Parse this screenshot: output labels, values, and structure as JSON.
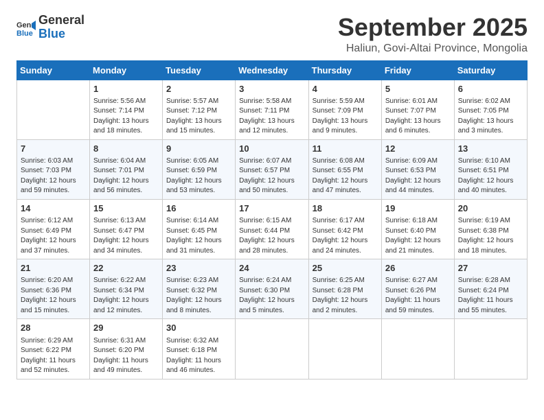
{
  "logo": {
    "general": "General",
    "blue": "Blue"
  },
  "title": "September 2025",
  "location": "Haliun, Govi-Altai Province, Mongolia",
  "days_of_week": [
    "Sunday",
    "Monday",
    "Tuesday",
    "Wednesday",
    "Thursday",
    "Friday",
    "Saturday"
  ],
  "weeks": [
    [
      {
        "day": "",
        "info": ""
      },
      {
        "day": "1",
        "info": "Sunrise: 5:56 AM\nSunset: 7:14 PM\nDaylight: 13 hours\nand 18 minutes."
      },
      {
        "day": "2",
        "info": "Sunrise: 5:57 AM\nSunset: 7:12 PM\nDaylight: 13 hours\nand 15 minutes."
      },
      {
        "day": "3",
        "info": "Sunrise: 5:58 AM\nSunset: 7:11 PM\nDaylight: 13 hours\nand 12 minutes."
      },
      {
        "day": "4",
        "info": "Sunrise: 5:59 AM\nSunset: 7:09 PM\nDaylight: 13 hours\nand 9 minutes."
      },
      {
        "day": "5",
        "info": "Sunrise: 6:01 AM\nSunset: 7:07 PM\nDaylight: 13 hours\nand 6 minutes."
      },
      {
        "day": "6",
        "info": "Sunrise: 6:02 AM\nSunset: 7:05 PM\nDaylight: 13 hours\nand 3 minutes."
      }
    ],
    [
      {
        "day": "7",
        "info": "Sunrise: 6:03 AM\nSunset: 7:03 PM\nDaylight: 12 hours\nand 59 minutes."
      },
      {
        "day": "8",
        "info": "Sunrise: 6:04 AM\nSunset: 7:01 PM\nDaylight: 12 hours\nand 56 minutes."
      },
      {
        "day": "9",
        "info": "Sunrise: 6:05 AM\nSunset: 6:59 PM\nDaylight: 12 hours\nand 53 minutes."
      },
      {
        "day": "10",
        "info": "Sunrise: 6:07 AM\nSunset: 6:57 PM\nDaylight: 12 hours\nand 50 minutes."
      },
      {
        "day": "11",
        "info": "Sunrise: 6:08 AM\nSunset: 6:55 PM\nDaylight: 12 hours\nand 47 minutes."
      },
      {
        "day": "12",
        "info": "Sunrise: 6:09 AM\nSunset: 6:53 PM\nDaylight: 12 hours\nand 44 minutes."
      },
      {
        "day": "13",
        "info": "Sunrise: 6:10 AM\nSunset: 6:51 PM\nDaylight: 12 hours\nand 40 minutes."
      }
    ],
    [
      {
        "day": "14",
        "info": "Sunrise: 6:12 AM\nSunset: 6:49 PM\nDaylight: 12 hours\nand 37 minutes."
      },
      {
        "day": "15",
        "info": "Sunrise: 6:13 AM\nSunset: 6:47 PM\nDaylight: 12 hours\nand 34 minutes."
      },
      {
        "day": "16",
        "info": "Sunrise: 6:14 AM\nSunset: 6:45 PM\nDaylight: 12 hours\nand 31 minutes."
      },
      {
        "day": "17",
        "info": "Sunrise: 6:15 AM\nSunset: 6:44 PM\nDaylight: 12 hours\nand 28 minutes."
      },
      {
        "day": "18",
        "info": "Sunrise: 6:17 AM\nSunset: 6:42 PM\nDaylight: 12 hours\nand 24 minutes."
      },
      {
        "day": "19",
        "info": "Sunrise: 6:18 AM\nSunset: 6:40 PM\nDaylight: 12 hours\nand 21 minutes."
      },
      {
        "day": "20",
        "info": "Sunrise: 6:19 AM\nSunset: 6:38 PM\nDaylight: 12 hours\nand 18 minutes."
      }
    ],
    [
      {
        "day": "21",
        "info": "Sunrise: 6:20 AM\nSunset: 6:36 PM\nDaylight: 12 hours\nand 15 minutes."
      },
      {
        "day": "22",
        "info": "Sunrise: 6:22 AM\nSunset: 6:34 PM\nDaylight: 12 hours\nand 12 minutes."
      },
      {
        "day": "23",
        "info": "Sunrise: 6:23 AM\nSunset: 6:32 PM\nDaylight: 12 hours\nand 8 minutes."
      },
      {
        "day": "24",
        "info": "Sunrise: 6:24 AM\nSunset: 6:30 PM\nDaylight: 12 hours\nand 5 minutes."
      },
      {
        "day": "25",
        "info": "Sunrise: 6:25 AM\nSunset: 6:28 PM\nDaylight: 12 hours\nand 2 minutes."
      },
      {
        "day": "26",
        "info": "Sunrise: 6:27 AM\nSunset: 6:26 PM\nDaylight: 11 hours\nand 59 minutes."
      },
      {
        "day": "27",
        "info": "Sunrise: 6:28 AM\nSunset: 6:24 PM\nDaylight: 11 hours\nand 55 minutes."
      }
    ],
    [
      {
        "day": "28",
        "info": "Sunrise: 6:29 AM\nSunset: 6:22 PM\nDaylight: 11 hours\nand 52 minutes."
      },
      {
        "day": "29",
        "info": "Sunrise: 6:31 AM\nSunset: 6:20 PM\nDaylight: 11 hours\nand 49 minutes."
      },
      {
        "day": "30",
        "info": "Sunrise: 6:32 AM\nSunset: 6:18 PM\nDaylight: 11 hours\nand 46 minutes."
      },
      {
        "day": "",
        "info": ""
      },
      {
        "day": "",
        "info": ""
      },
      {
        "day": "",
        "info": ""
      },
      {
        "day": "",
        "info": ""
      }
    ]
  ]
}
